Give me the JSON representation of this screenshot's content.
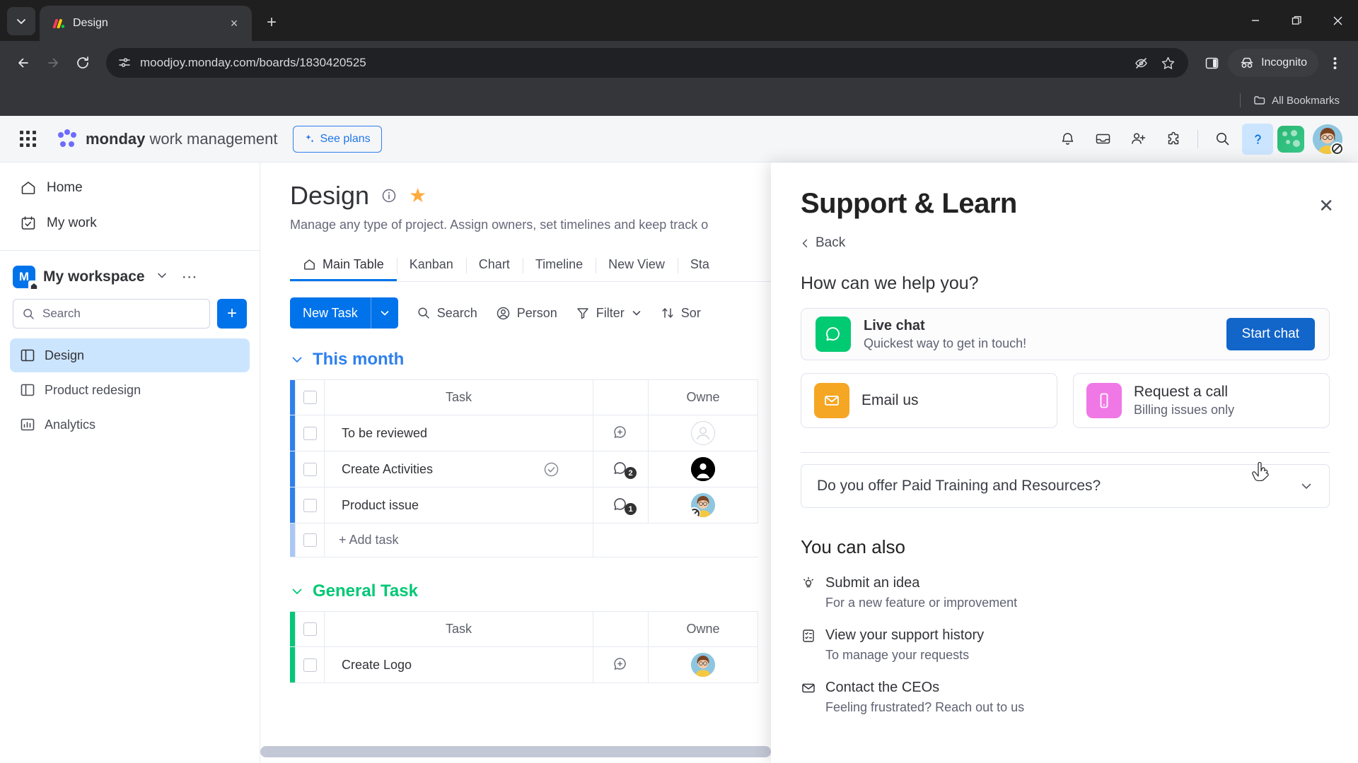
{
  "browser": {
    "tab": {
      "title": "Design",
      "favicon": "monday-icon",
      "close_label": "×"
    },
    "new_tab_label": "+",
    "url": "moodjoy.monday.com/boards/1830420525",
    "incognito_label": "Incognito",
    "bookmarks_label": "All Bookmarks",
    "window": {
      "minimize": "—",
      "maximize": "❐",
      "close": "✕"
    }
  },
  "md_header": {
    "brand_bold": "monday",
    "brand_rest": " work management",
    "see_plans": "See plans",
    "icons": [
      "notifications-bell-icon",
      "inbox-icon",
      "invite-member-icon",
      "apps-puzzle-icon",
      "search-icon",
      "help-question-icon"
    ]
  },
  "sidebar": {
    "nav": [
      {
        "label": "Home",
        "icon": "home-icon"
      },
      {
        "label": "My work",
        "icon": "my-work-calendar-icon"
      }
    ],
    "workspace": {
      "initial": "M",
      "name": "My workspace"
    },
    "search_placeholder": "Search",
    "add_label": "+",
    "boards": [
      {
        "label": "Design",
        "icon": "board-icon",
        "active": true
      },
      {
        "label": "Product redesign",
        "icon": "board-icon",
        "active": false
      },
      {
        "label": "Analytics",
        "icon": "dashboard-chart-icon",
        "active": false
      }
    ]
  },
  "board": {
    "title": "Design",
    "description": "Manage any type of project. Assign owners, set timelines and keep track o",
    "tabs": [
      {
        "label": "Main Table",
        "active": true
      },
      {
        "label": "Kanban",
        "active": false
      },
      {
        "label": "Chart",
        "active": false
      },
      {
        "label": "Timeline",
        "active": false
      },
      {
        "label": "New View",
        "active": false
      },
      {
        "label": "Sta",
        "active": false
      }
    ],
    "toolbar": {
      "new_task": "New Task",
      "items": [
        {
          "label": "Search",
          "icon": "search-icon"
        },
        {
          "label": "Person",
          "icon": "person-icon"
        },
        {
          "label": "Filter",
          "icon": "filter-icon",
          "caret": true
        },
        {
          "label": "Sor",
          "icon": "sort-icon"
        }
      ]
    },
    "columns": {
      "task": "Task",
      "owner": "Owne"
    },
    "groups": [
      {
        "name": "This month",
        "color": "#2f80ed",
        "rows": [
          {
            "task": "To be reviewed",
            "done": false,
            "conversation": "add",
            "comments": "",
            "owner": "empty"
          },
          {
            "task": "Create Activities",
            "done": true,
            "conversation": "count",
            "comments": "2",
            "owner": "dark"
          },
          {
            "task": "Product issue",
            "done": false,
            "conversation": "count",
            "comments": "1",
            "owner": "photo"
          }
        ],
        "add_task": "+ Add task"
      },
      {
        "name": "General Task",
        "color": "#00c875",
        "rows": [
          {
            "task": "Create Logo",
            "done": false,
            "conversation": "add",
            "comments": "",
            "owner": "photo"
          }
        ],
        "add_task": ""
      }
    ]
  },
  "panel": {
    "title": "Support & Learn",
    "back": "Back",
    "heading": "How can we help you?",
    "live_chat": {
      "title": "Live chat",
      "subtitle": "Quickest way to get in touch!",
      "button": "Start chat",
      "icon_color": "#00ca72"
    },
    "cards": [
      {
        "title": "Email us",
        "subtitle": "",
        "icon": "envelope-icon",
        "icon_color": "#f5a623"
      },
      {
        "title": "Request a call",
        "subtitle": "Billing issues only",
        "icon": "mobile-phone-icon",
        "icon_color": "#f078e6"
      }
    ],
    "faq": [
      {
        "question": "Do you offer Paid Training and Resources?"
      }
    ],
    "also_heading": "You can also",
    "also_items": [
      {
        "title": "Submit an idea",
        "subtitle": "For a new feature or improvement",
        "icon": "lightbulb-icon"
      },
      {
        "title": "View your support history",
        "subtitle": "To manage your requests",
        "icon": "history-list-icon"
      },
      {
        "title": "Contact the CEOs",
        "subtitle": "Feeling frustrated? Reach out to us",
        "icon": "envelope-icon"
      }
    ]
  }
}
